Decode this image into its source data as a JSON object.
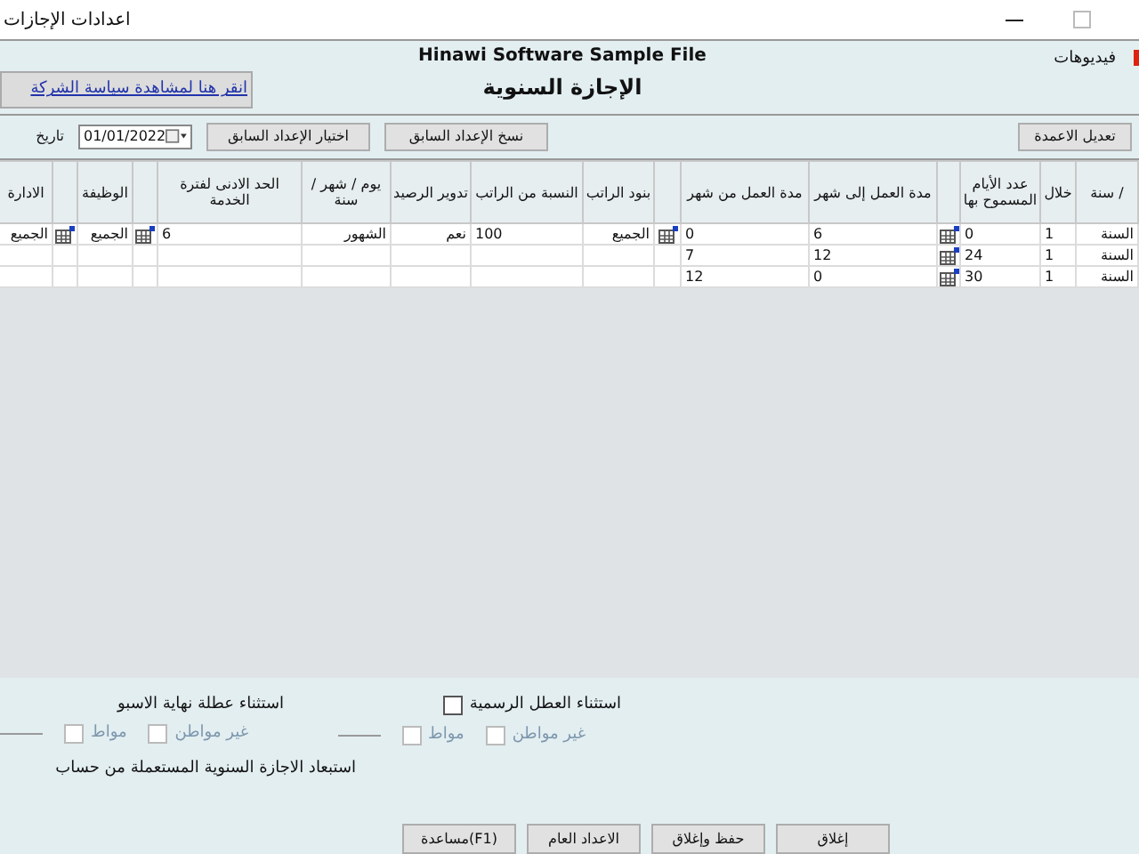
{
  "window": {
    "title": "اعدادات الإجازات"
  },
  "header": {
    "videos_link": "فيديوهات",
    "company": "Hinawi Software Sample File",
    "title": "الإجازة السنوية",
    "policy_link": "انقر هنا لمشاهدة سياسة الشركة"
  },
  "toolbar": {
    "edit_columns": "تعديل الاعمدة",
    "copy_button": "نسخ الإعداد السابق",
    "choose_button": "اختيار الإعداد السابق",
    "date": "01/01/2022",
    "date_label": "تاريخ"
  },
  "table": {
    "columns": [
      {
        "kind": "text",
        "label": "/ سنة"
      },
      {
        "kind": "text",
        "label": "خلال"
      },
      {
        "kind": "text",
        "label": "عدد الأيام المسموح بها"
      },
      {
        "kind": "icon"
      },
      {
        "kind": "text",
        "label": "مدة العمل إلى شهر"
      },
      {
        "kind": "text",
        "label": "مدة العمل من شهر"
      },
      {
        "kind": "icon"
      },
      {
        "kind": "text",
        "label": "بنود الراتب"
      },
      {
        "kind": "text",
        "label": "النسبة من الراتب"
      },
      {
        "kind": "text",
        "label": "تدوير الرصيد"
      },
      {
        "kind": "text",
        "label": "يوم / شهر / سنة"
      },
      {
        "kind": "text",
        "label": "الحد الادنى لفترة الخدمة"
      },
      {
        "kind": "icon"
      },
      {
        "kind": "text",
        "label": "الوظيفة"
      },
      {
        "kind": "icon"
      },
      {
        "kind": "text",
        "label": "الادارة"
      }
    ],
    "rows": [
      {
        "cells": [
          "السنة",
          "1",
          "0",
          true,
          "6",
          "0",
          true,
          "الجميع",
          "100",
          "نعم",
          "الشهور",
          "6",
          true,
          "الجميع",
          true,
          "الجميع"
        ]
      },
      {
        "cells": [
          "السنة",
          "1",
          "24",
          true,
          "12",
          "7",
          false,
          null,
          null,
          null,
          null,
          null,
          false,
          null,
          false,
          null
        ]
      },
      {
        "cells": [
          "السنة",
          "1",
          "30",
          true,
          "0",
          "12",
          false,
          null,
          null,
          null,
          null,
          null,
          false,
          null,
          false,
          null
        ]
      }
    ]
  },
  "options": [
    {
      "label": "استثناء العطل الرسمية",
      "checked": false,
      "sub": [
        {
          "label": "غير مواطن",
          "checked": false,
          "disabled": true
        },
        {
          "label": "مواط",
          "checked": false,
          "disabled": true
        }
      ]
    },
    {
      "label": "استثناء عطلة نهاية الاسبو",
      "sub": [
        {
          "label": "غير مواطن",
          "checked": false,
          "disabled": true
        },
        {
          "label": "مواط",
          "checked": false,
          "disabled": true
        }
      ]
    }
  ],
  "exclude_note": "استبعاد الاجازة السنوية المستعملة من حساب",
  "buttons": [
    "إغلاق",
    "حفظ وإغلاق",
    "الاعداد العام",
    "(F1)مساعدة"
  ]
}
